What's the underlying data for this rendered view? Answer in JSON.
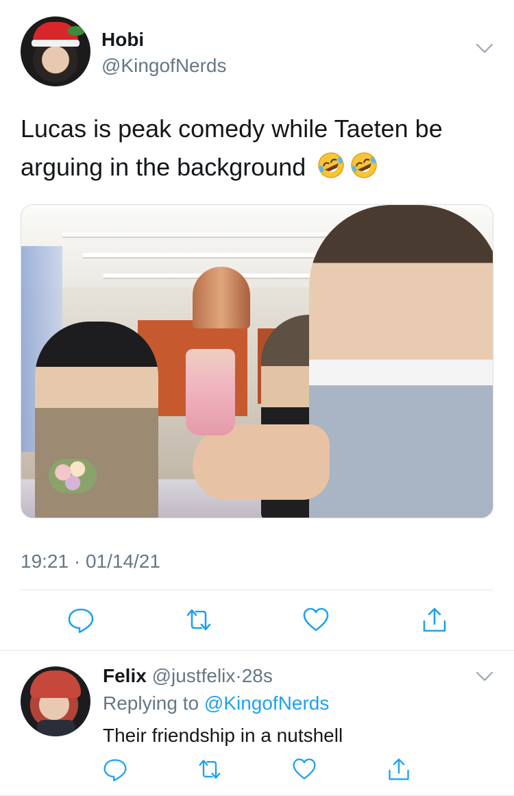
{
  "tweet": {
    "author_name": "Hobi",
    "author_handle": "@KingofNerds",
    "text": "Lucas is peak comedy while Taeten be arguing in the background",
    "emojis": [
      "rolling-on-floor-laughing",
      "rolling-on-floor-laughing"
    ],
    "timestamp": "19:21 · 01/14/21",
    "actions": [
      "reply-icon",
      "retweet-icon",
      "like-icon",
      "share-icon"
    ]
  },
  "reply": {
    "author_name": "Felix",
    "author_handle": "@justfelix",
    "separator": "·",
    "time": "28s",
    "replying_prefix": "Replying to",
    "replying_to": "@KingofNerds",
    "text": "Their friendship in a nutshell"
  },
  "colors": {
    "text": "#14171a",
    "secondary": "#657786",
    "link": "#1da1f2",
    "divider": "#e1e8ed"
  }
}
